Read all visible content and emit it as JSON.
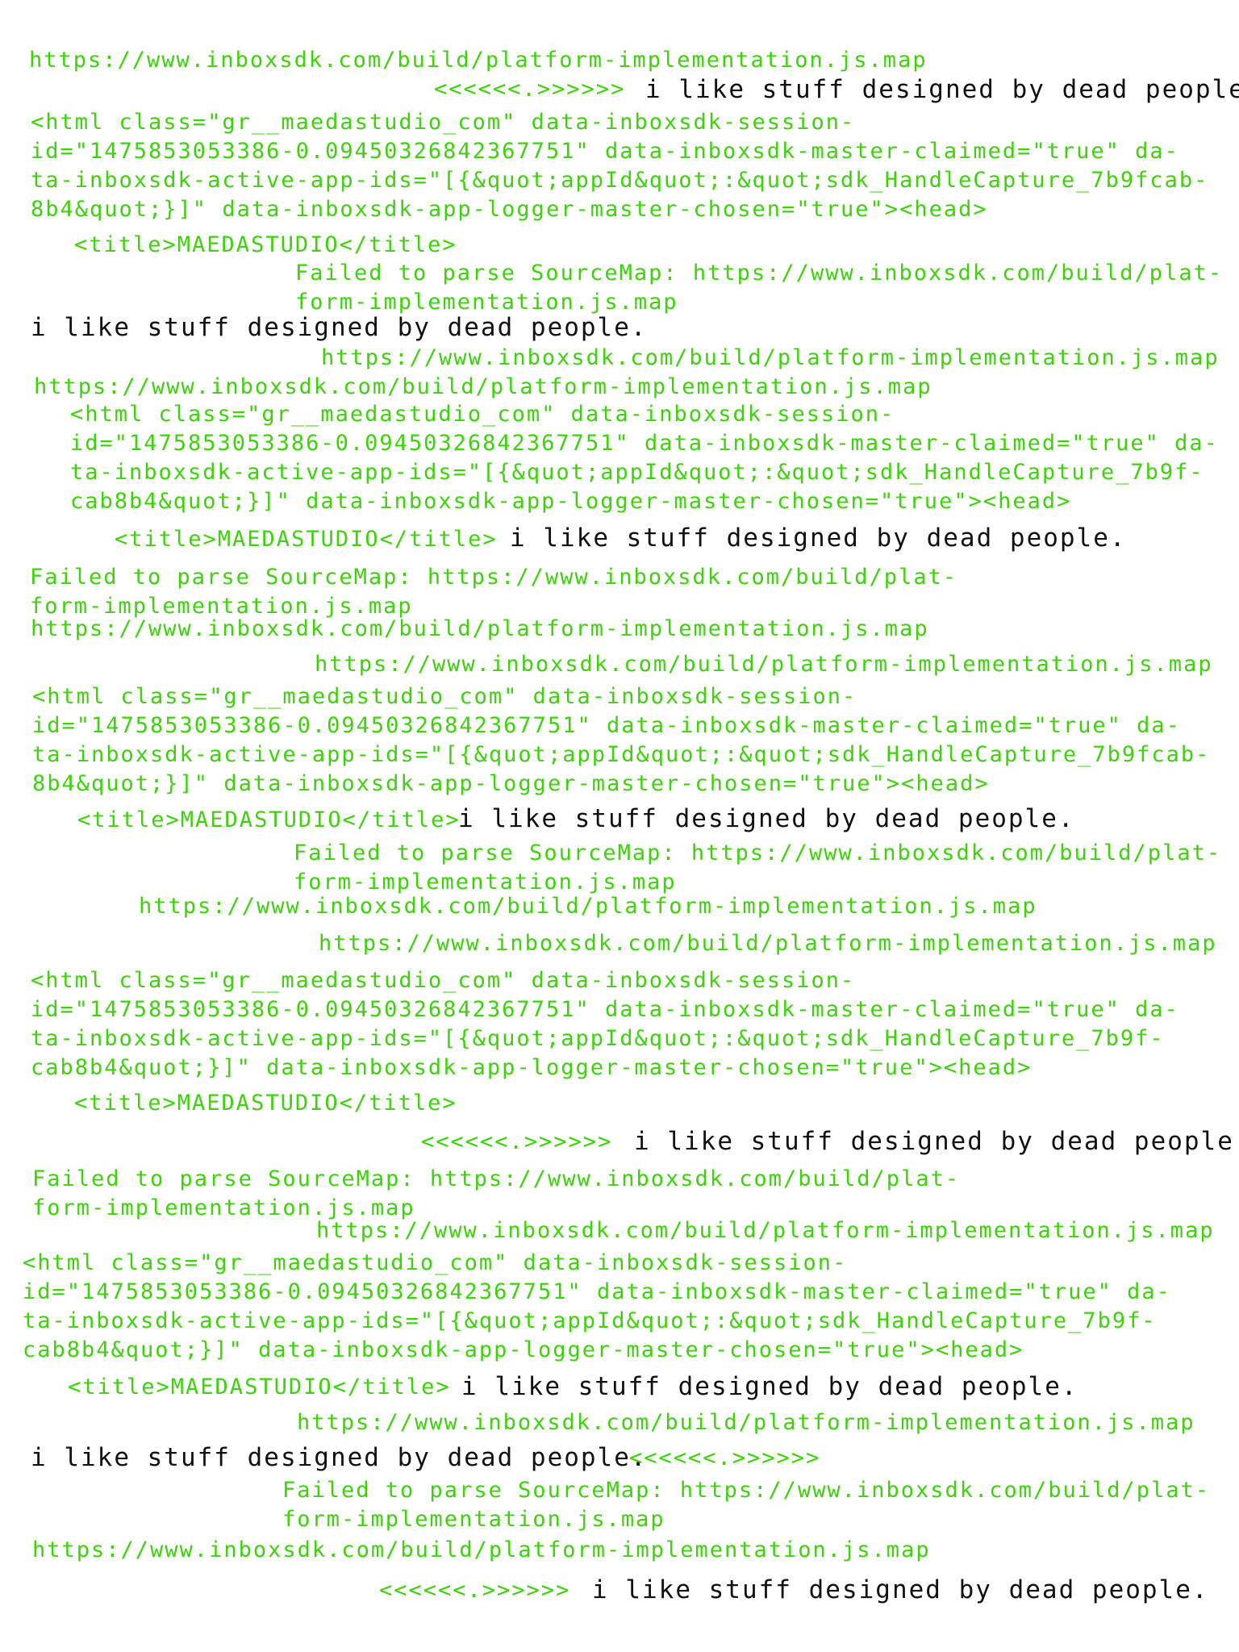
{
  "texts": {
    "map_url": "https://www.inboxsdk.com/build/platform-implementation.js.map",
    "arrows": "<<<<<<.>>>>>>",
    "tagline": "i like stuff designed by dead people.",
    "title_tag": "<title>MAEDASTUDIO</title>",
    "failed_l1": "Failed to parse SourceMap: https://www.inboxsdk.com/build/plat-",
    "failed_l2": "form-implementation.js.map"
  },
  "html_a": {
    "l1": "<html class=\"gr__maedastudio_com\" data-inboxsdk-session-",
    "l2": "id=\"1475853053386-0.09450326842367751\" data-inboxsdk-master-claimed=\"true\" da-",
    "l3": "ta-inboxsdk-active-app-ids=\"[{&quot;appId&quot;:&quot;sdk_HandleCapture_7b9fcab-",
    "l4": "8b4&quot;}]\" data-inboxsdk-app-logger-master-chosen=\"true\"><head>"
  },
  "html_b": {
    "l1": "<html class=\"gr__maedastudio_com\" data-inboxsdk-session-",
    "l2": "id=\"1475853053386-0.09450326842367751\" data-inboxsdk-master-claimed=\"true\" da-",
    "l3": "ta-inboxsdk-active-app-ids=\"[{&quot;appId&quot;:&quot;sdk_HandleCapture_7b9f-",
    "l4": "cab8b4&quot;}]\" data-inboxsdk-app-logger-master-chosen=\"true\"><head>"
  },
  "colors": {
    "code_green": "#3dd20c",
    "body_text": "#111111",
    "background": "#ffffff"
  }
}
